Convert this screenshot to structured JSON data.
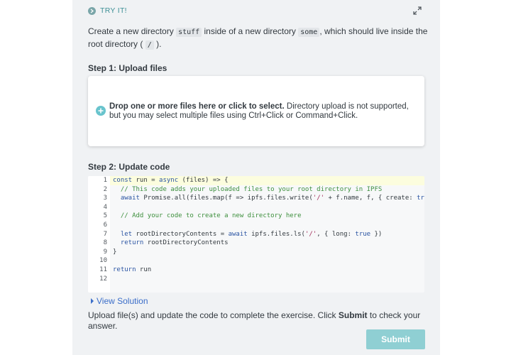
{
  "header": {
    "tryit_label": "TRY IT!"
  },
  "prompt": {
    "part1": "Create a new directory ",
    "dir1": "stuff",
    "part2": " inside of a new directory ",
    "dir2": "some",
    "part3": ", which should live inside the root directory ( ",
    "root": "/",
    "part4": " )."
  },
  "step1": {
    "title": "Step 1: Upload files",
    "drop_bold": "Drop one or more files here or click to select.",
    "drop_note": " Directory upload is not supported, but you may select multiple files using Ctrl+Click or Command+Click."
  },
  "step2": {
    "title": "Step 2: Update code"
  },
  "editor": {
    "line_numbers": [
      "1",
      "2",
      "3",
      "4",
      "5",
      "6",
      "7",
      "8",
      "9",
      "10",
      "11",
      "12"
    ],
    "lines": [
      "const run = async (files) => {",
      "  // This code adds your uploaded files to your root directory in IPFS",
      "  await Promise.all(files.map(f => ipfs.files.write('/' + f.name, f, { create: true })))",
      "",
      "  // Add your code to create a new directory here",
      "",
      "  let rootDirectoryContents = await ipfs.files.ls('/', { long: true })",
      "  return rootDirectoryContents",
      "}",
      "",
      "return run",
      ""
    ]
  },
  "footer": {
    "view_solution": "View Solution",
    "hint_part1": "Upload file(s) and update the code to complete the exercise. Click ",
    "hint_bold": "Submit",
    "hint_part2": " to check your answer.",
    "submit_label": "Submit"
  },
  "colors": {
    "accent": "#3e9096",
    "submit_disabled": "#8fcfd3",
    "link": "#3b6ec9"
  }
}
